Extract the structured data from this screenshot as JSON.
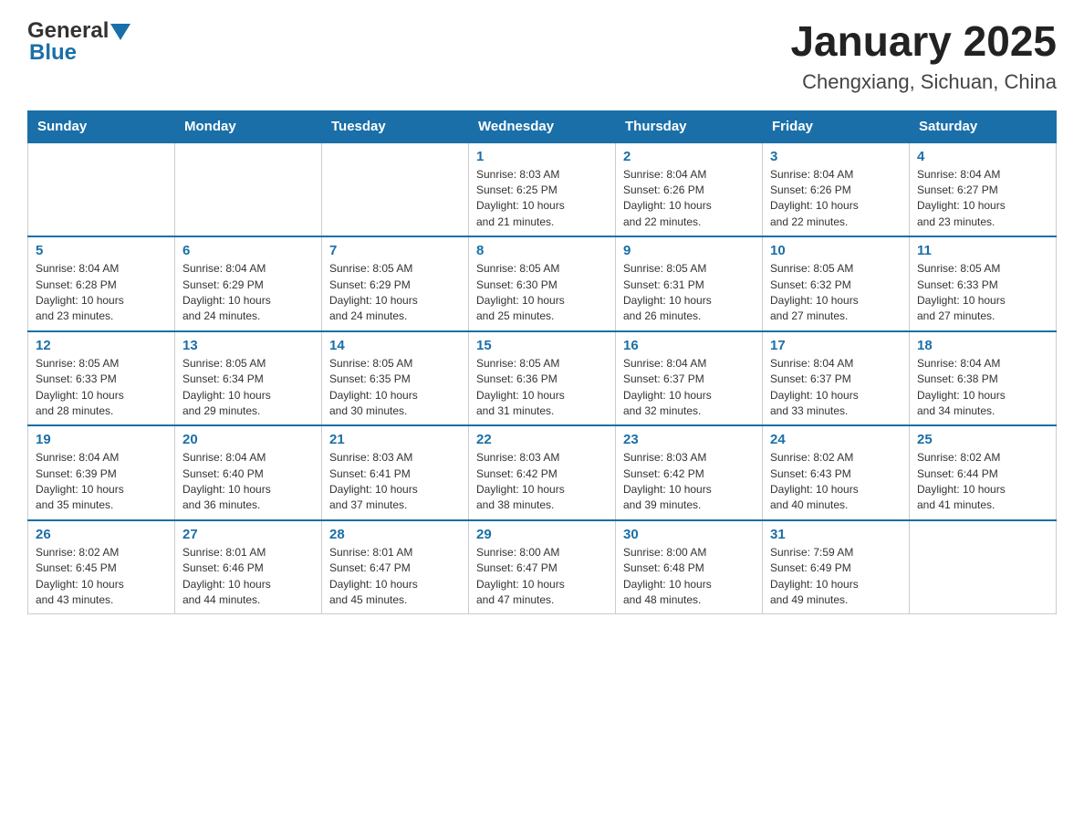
{
  "header": {
    "logo_general": "General",
    "logo_blue": "Blue",
    "month": "January 2025",
    "location": "Chengxiang, Sichuan, China"
  },
  "days_of_week": [
    "Sunday",
    "Monday",
    "Tuesday",
    "Wednesday",
    "Thursday",
    "Friday",
    "Saturday"
  ],
  "weeks": [
    [
      {
        "day": "",
        "info": ""
      },
      {
        "day": "",
        "info": ""
      },
      {
        "day": "",
        "info": ""
      },
      {
        "day": "1",
        "info": "Sunrise: 8:03 AM\nSunset: 6:25 PM\nDaylight: 10 hours\nand 21 minutes."
      },
      {
        "day": "2",
        "info": "Sunrise: 8:04 AM\nSunset: 6:26 PM\nDaylight: 10 hours\nand 22 minutes."
      },
      {
        "day": "3",
        "info": "Sunrise: 8:04 AM\nSunset: 6:26 PM\nDaylight: 10 hours\nand 22 minutes."
      },
      {
        "day": "4",
        "info": "Sunrise: 8:04 AM\nSunset: 6:27 PM\nDaylight: 10 hours\nand 23 minutes."
      }
    ],
    [
      {
        "day": "5",
        "info": "Sunrise: 8:04 AM\nSunset: 6:28 PM\nDaylight: 10 hours\nand 23 minutes."
      },
      {
        "day": "6",
        "info": "Sunrise: 8:04 AM\nSunset: 6:29 PM\nDaylight: 10 hours\nand 24 minutes."
      },
      {
        "day": "7",
        "info": "Sunrise: 8:05 AM\nSunset: 6:29 PM\nDaylight: 10 hours\nand 24 minutes."
      },
      {
        "day": "8",
        "info": "Sunrise: 8:05 AM\nSunset: 6:30 PM\nDaylight: 10 hours\nand 25 minutes."
      },
      {
        "day": "9",
        "info": "Sunrise: 8:05 AM\nSunset: 6:31 PM\nDaylight: 10 hours\nand 26 minutes."
      },
      {
        "day": "10",
        "info": "Sunrise: 8:05 AM\nSunset: 6:32 PM\nDaylight: 10 hours\nand 27 minutes."
      },
      {
        "day": "11",
        "info": "Sunrise: 8:05 AM\nSunset: 6:33 PM\nDaylight: 10 hours\nand 27 minutes."
      }
    ],
    [
      {
        "day": "12",
        "info": "Sunrise: 8:05 AM\nSunset: 6:33 PM\nDaylight: 10 hours\nand 28 minutes."
      },
      {
        "day": "13",
        "info": "Sunrise: 8:05 AM\nSunset: 6:34 PM\nDaylight: 10 hours\nand 29 minutes."
      },
      {
        "day": "14",
        "info": "Sunrise: 8:05 AM\nSunset: 6:35 PM\nDaylight: 10 hours\nand 30 minutes."
      },
      {
        "day": "15",
        "info": "Sunrise: 8:05 AM\nSunset: 6:36 PM\nDaylight: 10 hours\nand 31 minutes."
      },
      {
        "day": "16",
        "info": "Sunrise: 8:04 AM\nSunset: 6:37 PM\nDaylight: 10 hours\nand 32 minutes."
      },
      {
        "day": "17",
        "info": "Sunrise: 8:04 AM\nSunset: 6:37 PM\nDaylight: 10 hours\nand 33 minutes."
      },
      {
        "day": "18",
        "info": "Sunrise: 8:04 AM\nSunset: 6:38 PM\nDaylight: 10 hours\nand 34 minutes."
      }
    ],
    [
      {
        "day": "19",
        "info": "Sunrise: 8:04 AM\nSunset: 6:39 PM\nDaylight: 10 hours\nand 35 minutes."
      },
      {
        "day": "20",
        "info": "Sunrise: 8:04 AM\nSunset: 6:40 PM\nDaylight: 10 hours\nand 36 minutes."
      },
      {
        "day": "21",
        "info": "Sunrise: 8:03 AM\nSunset: 6:41 PM\nDaylight: 10 hours\nand 37 minutes."
      },
      {
        "day": "22",
        "info": "Sunrise: 8:03 AM\nSunset: 6:42 PM\nDaylight: 10 hours\nand 38 minutes."
      },
      {
        "day": "23",
        "info": "Sunrise: 8:03 AM\nSunset: 6:42 PM\nDaylight: 10 hours\nand 39 minutes."
      },
      {
        "day": "24",
        "info": "Sunrise: 8:02 AM\nSunset: 6:43 PM\nDaylight: 10 hours\nand 40 minutes."
      },
      {
        "day": "25",
        "info": "Sunrise: 8:02 AM\nSunset: 6:44 PM\nDaylight: 10 hours\nand 41 minutes."
      }
    ],
    [
      {
        "day": "26",
        "info": "Sunrise: 8:02 AM\nSunset: 6:45 PM\nDaylight: 10 hours\nand 43 minutes."
      },
      {
        "day": "27",
        "info": "Sunrise: 8:01 AM\nSunset: 6:46 PM\nDaylight: 10 hours\nand 44 minutes."
      },
      {
        "day": "28",
        "info": "Sunrise: 8:01 AM\nSunset: 6:47 PM\nDaylight: 10 hours\nand 45 minutes."
      },
      {
        "day": "29",
        "info": "Sunrise: 8:00 AM\nSunset: 6:47 PM\nDaylight: 10 hours\nand 47 minutes."
      },
      {
        "day": "30",
        "info": "Sunrise: 8:00 AM\nSunset: 6:48 PM\nDaylight: 10 hours\nand 48 minutes."
      },
      {
        "day": "31",
        "info": "Sunrise: 7:59 AM\nSunset: 6:49 PM\nDaylight: 10 hours\nand 49 minutes."
      },
      {
        "day": "",
        "info": ""
      }
    ]
  ]
}
